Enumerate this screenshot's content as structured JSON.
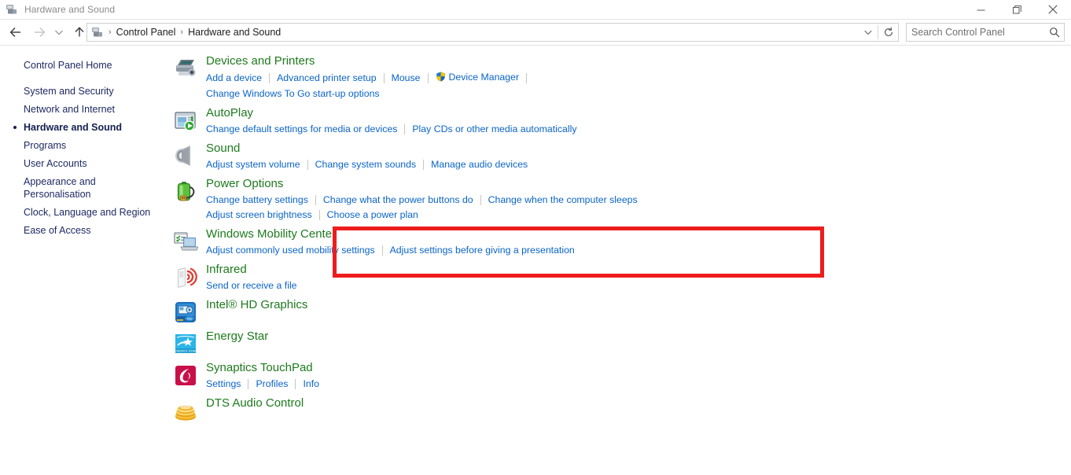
{
  "window": {
    "title": "Hardware and Sound",
    "title_icon": "printer-device-icon",
    "minimize_label": "Minimize",
    "maximize_label": "Restore",
    "close_label": "Close"
  },
  "navigation": {
    "back_label": "Back",
    "forward_label": "Forward",
    "recent_label": "Recent locations",
    "up_label": "Up one level",
    "address_icon": "printer-device-icon",
    "breadcrumbs": [
      "Control Panel",
      "Hardware and Sound"
    ],
    "separator": "›",
    "dropdown_label": "Previous locations",
    "refresh_label": "Refresh"
  },
  "search": {
    "placeholder": "Search Control Panel",
    "value": "",
    "icon": "search-icon"
  },
  "sidebar": {
    "home": "Control Panel Home",
    "items": [
      {
        "label": "System and Security",
        "current": false
      },
      {
        "label": "Network and Internet",
        "current": false
      },
      {
        "label": "Hardware and Sound",
        "current": true
      },
      {
        "label": "Programs",
        "current": false
      },
      {
        "label": "User Accounts",
        "current": false
      },
      {
        "label": "Appearance and Personalisation",
        "current": false
      },
      {
        "label": "Clock, Language and Region",
        "current": false
      },
      {
        "label": "Ease of Access",
        "current": false
      }
    ]
  },
  "highlight": {
    "target": "Power Options",
    "color": "#ee1d1d"
  },
  "colors": {
    "heading": "#1d7a1d",
    "link": "#0a64c8",
    "sidebar_text": "#1f2a63",
    "highlight": "#ee1d1d"
  },
  "sections": [
    {
      "title": "Devices and Printers",
      "icon": "printer-icon",
      "rows": [
        [
          {
            "label": "Add a device",
            "shield": false
          },
          {
            "label": "Advanced printer setup",
            "shield": false
          },
          {
            "label": "Mouse",
            "shield": false
          },
          {
            "label": "Device Manager",
            "shield": true
          }
        ],
        [
          {
            "label": "Change Windows To Go start-up options",
            "shield": false
          }
        ]
      ]
    },
    {
      "title": "AutoPlay",
      "icon": "autoplay-icon",
      "rows": [
        [
          {
            "label": "Change default settings for media or devices",
            "shield": false
          },
          {
            "label": "Play CDs or other media automatically",
            "shield": false
          }
        ]
      ]
    },
    {
      "title": "Sound",
      "icon": "speaker-icon",
      "rows": [
        [
          {
            "label": "Adjust system volume",
            "shield": false
          },
          {
            "label": "Change system sounds",
            "shield": false
          },
          {
            "label": "Manage audio devices",
            "shield": false
          }
        ]
      ]
    },
    {
      "title": "Power Options",
      "icon": "battery-icon",
      "rows": [
        [
          {
            "label": "Change battery settings",
            "shield": false
          },
          {
            "label": "Change what the power buttons do",
            "shield": false
          },
          {
            "label": "Change when the computer sleeps",
            "shield": false
          }
        ],
        [
          {
            "label": "Adjust screen brightness",
            "shield": false
          },
          {
            "label": "Choose a power plan",
            "shield": false
          }
        ]
      ]
    },
    {
      "title": "Windows Mobility Center",
      "icon": "mobility-center-icon",
      "rows": [
        [
          {
            "label": "Adjust commonly used mobility settings",
            "shield": false
          },
          {
            "label": "Adjust settings before giving a presentation",
            "shield": false
          }
        ]
      ]
    },
    {
      "title": "Infrared",
      "icon": "infrared-icon",
      "rows": [
        [
          {
            "label": "Send or receive a file",
            "shield": false
          }
        ]
      ]
    },
    {
      "title": "Intel® HD Graphics",
      "icon": "intel-graphics-icon",
      "rows": []
    },
    {
      "title": "Energy Star",
      "icon": "energy-star-icon",
      "rows": []
    },
    {
      "title": "Synaptics TouchPad",
      "icon": "synaptics-icon",
      "rows": [
        [
          {
            "label": "Settings",
            "shield": false
          },
          {
            "label": "Profiles",
            "shield": false
          },
          {
            "label": "Info",
            "shield": false
          }
        ]
      ]
    },
    {
      "title": "DTS Audio Control",
      "icon": "dts-audio-icon",
      "rows": []
    }
  ]
}
